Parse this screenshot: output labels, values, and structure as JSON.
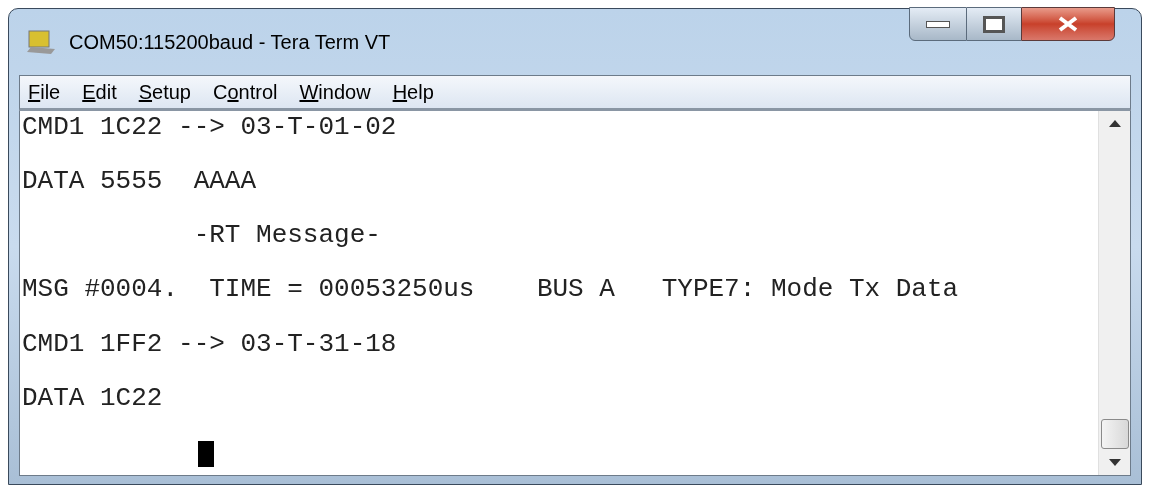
{
  "window": {
    "title": "COM50:115200baud - Tera Term VT"
  },
  "menu": [
    {
      "key": "F",
      "after": "ile"
    },
    {
      "key": "E",
      "after": "dit"
    },
    {
      "key": "S",
      "after": "etup"
    },
    {
      "before": "C",
      "key": "o",
      "after": "ntrol"
    },
    {
      "key": "W",
      "after": "indow"
    },
    {
      "key": "H",
      "after": "elp"
    }
  ],
  "terminal": {
    "lines": [
      "CMD1 1C22 --> 03-T-01-02",
      "DATA 5555  AAAA",
      "           -RT Message-",
      "MSG #0004.  TIME = 00053250us    BUS A   TYPE7: Mode Tx Data",
      "CMD1 1FF2 --> 03-T-31-18",
      "DATA 1C22"
    ]
  }
}
